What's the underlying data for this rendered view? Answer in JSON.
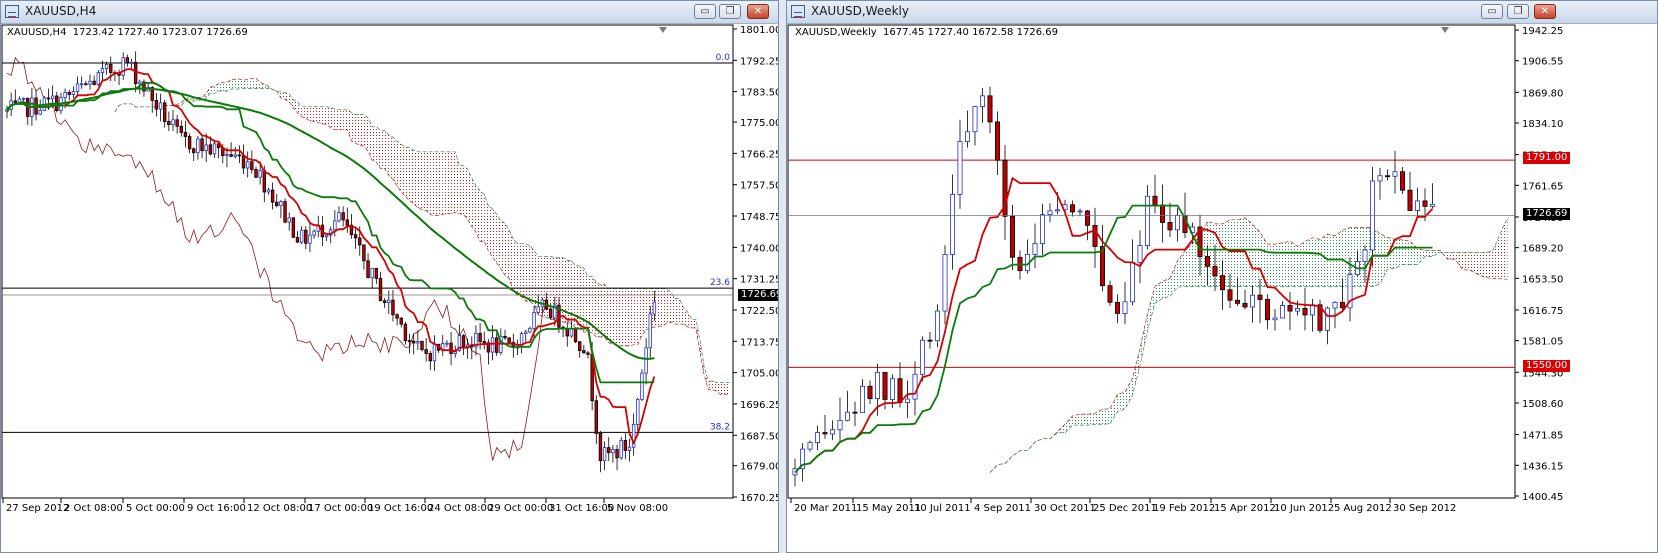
{
  "windows": [
    {
      "title": "XAUUSD,H4",
      "ohlc_text": "XAUUSD,H4  1723.42 1727.40 1723.07 1726.69",
      "price_ticks": [
        "1801.00",
        "1792.25",
        "1783.50",
        "1775.00",
        "1766.25",
        "1757.50",
        "1748.75",
        "1740.00",
        "1731.25",
        "1722.50",
        "1713.75",
        "1705.00",
        "1696.25",
        "1687.50",
        "1679.00",
        "1670.25"
      ],
      "time_ticks": [
        "27 Sep 2012",
        "2 Oct 08:00",
        "5 Oct 00:00",
        "9 Oct 16:00",
        "12 Oct 08:00",
        "17 Oct 00:00",
        "19 Oct 16:00",
        "24 Oct 08:00",
        "29 Oct 00:00",
        "31 Oct 16:00",
        "5 Nov 08:00"
      ],
      "current_price": "1726.69",
      "fib_labels": [
        "0.0",
        "23.6",
        "38.2"
      ]
    },
    {
      "title": "XAUUSD,Weekly",
      "ohlc_text": "XAUUSD,Weekly  1677.45 1727.40 1672.58 1726.69",
      "price_ticks": [
        "1942.25",
        "1906.55",
        "1869.80",
        "1834.10",
        "1797.35",
        "1761.65",
        "1724.90",
        "1689.20",
        "1653.50",
        "1616.75",
        "1581.05",
        "1544.30",
        "1508.60",
        "1471.85",
        "1436.15",
        "1400.45"
      ],
      "time_ticks": [
        "20 Mar 2011",
        "15 May 2011",
        "10 Jul 2011",
        "4 Sep 2011",
        "30 Oct 2011",
        "25 Dec 2011",
        "19 Feb 2012",
        "15 Apr 2012",
        "10 Jun 2012",
        "5 Aug 2012",
        "30 Sep 2012"
      ],
      "current_price": "1726.69",
      "levels": [
        "1791.00",
        "1550.00"
      ]
    }
  ],
  "window_buttons": {
    "minimize": "▭",
    "restore": "❐",
    "close": "✕"
  },
  "colors": {
    "bull": "#2030d0",
    "bear": "#c00000",
    "tenkan": "#d40000",
    "kijun": "#0a7a0a",
    "chikou": "#8b1a1a",
    "cloud_bull": "#2e8b57",
    "cloud_bear": "#b22222",
    "level": "#d80000"
  }
}
